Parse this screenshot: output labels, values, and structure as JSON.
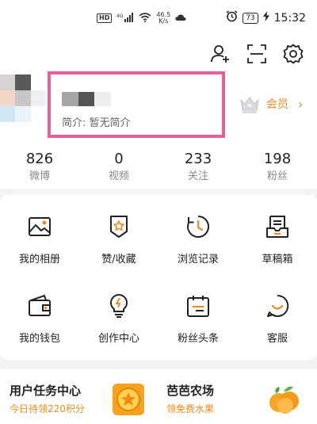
{
  "status_bar": {
    "hd": "HD",
    "signal": "4G",
    "speed_value": "46.5",
    "speed_unit": "K/s",
    "battery": "73",
    "time": "15:32"
  },
  "header": {
    "icons": [
      "add-friend-icon",
      "scan-icon",
      "settings-icon"
    ],
    "intro_text": "简介: 暂无简介",
    "vip_label": "会员",
    "vip_arrow": "›",
    "highlight_color": "#e8609a"
  },
  "stats": [
    {
      "value": "826",
      "label": "微博"
    },
    {
      "value": "0",
      "label": "视频"
    },
    {
      "value": "233",
      "label": "关注"
    },
    {
      "value": "198",
      "label": "粉丝"
    }
  ],
  "grid": {
    "row1": [
      {
        "label": "我的相册",
        "icon": "album-icon"
      },
      {
        "label": "赞/收藏",
        "icon": "like-favorite-icon"
      },
      {
        "label": "浏览记录",
        "icon": "history-icon"
      },
      {
        "label": "草稿箱",
        "icon": "drafts-icon"
      }
    ],
    "row2": [
      {
        "label": "我的钱包",
        "icon": "wallet-icon"
      },
      {
        "label": "创作中心",
        "icon": "creator-icon"
      },
      {
        "label": "粉丝头条",
        "icon": "fans-headline-icon"
      },
      {
        "label": "客服",
        "icon": "customer-service-icon"
      }
    ]
  },
  "task_center": {
    "title": "用户任务中心",
    "subtitle": "今日待领220积分"
  },
  "farm": {
    "title": "芭芭农场",
    "subtitle": "领免费水果"
  },
  "colors": {
    "accent": "#f08a1c",
    "icon": "#222222"
  }
}
